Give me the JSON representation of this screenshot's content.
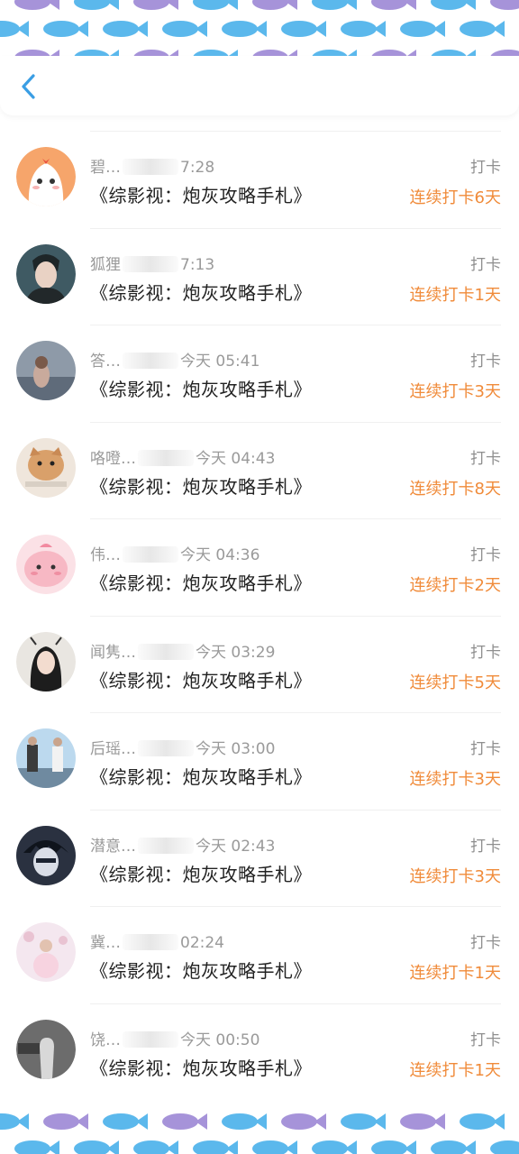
{
  "header": {
    "back_icon": "chevron-left-icon",
    "accent": "#3a9ee4"
  },
  "colors": {
    "streak": "#f08b3a",
    "fish_blue": "#5bb8ec",
    "fish_purple": "#a693d9"
  },
  "items": [
    {
      "name": "碧…",
      "time": "7:28",
      "action": "打卡",
      "book": "《综影视：炮灰攻略手札》",
      "streak": "连续打卡6天",
      "avatar": "ghost-cartoon"
    },
    {
      "name": "狐狸",
      "time": "7:13",
      "action": "打卡",
      "book": "《综影视：炮灰攻略手札》",
      "streak": "连续打卡1天",
      "avatar": "portrait-man"
    },
    {
      "name": "答…",
      "time": "今天 05:41",
      "action": "打卡",
      "book": "《综影视：炮灰攻略手札》",
      "streak": "连续打卡3天",
      "avatar": "photo-girl"
    },
    {
      "name": "咯噔…",
      "time": "今天 04:43",
      "action": "打卡",
      "book": "《综影视：炮灰攻略手札》",
      "streak": "连续打卡8天",
      "avatar": "cat-photo"
    },
    {
      "name": "伟…",
      "time": "今天 04:36",
      "action": "打卡",
      "book": "《综影视：炮灰攻略手札》",
      "streak": "连续打卡2天",
      "avatar": "pink-cartoon"
    },
    {
      "name": "闻隽…",
      "time": "今天 03:29",
      "action": "打卡",
      "book": "《综影视：炮灰攻略手札》",
      "streak": "连续打卡5天",
      "avatar": "drawn-girl"
    },
    {
      "name": "后瑶…",
      "time": "今天 03:00",
      "action": "打卡",
      "book": "《综影视：炮灰攻略手札》",
      "streak": "连续打卡3天",
      "avatar": "two-people"
    },
    {
      "name": "潜意…",
      "time": "今天 02:43",
      "action": "打卡",
      "book": "《综影视：炮灰攻略手札》",
      "streak": "连续打卡3天",
      "avatar": "anime-boy"
    },
    {
      "name": "冀…",
      "time": "02:24",
      "action": "打卡",
      "book": "《综影视：炮灰攻略手札》",
      "streak": "连续打卡1天",
      "avatar": "girl-pink"
    },
    {
      "name": "饶…",
      "time": "今天 00:50",
      "action": "打卡",
      "book": "《综影视：炮灰攻略手札》",
      "streak": "连续打卡1天",
      "avatar": "hand-dark"
    }
  ]
}
